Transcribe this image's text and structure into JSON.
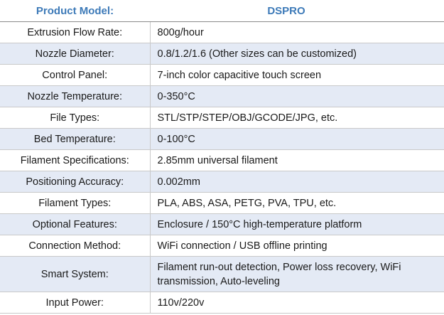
{
  "header": {
    "label": "Product Model:",
    "value": "DSPRO"
  },
  "rows": [
    {
      "label": "Extrusion Flow Rate:",
      "value": "800g/hour"
    },
    {
      "label": "Nozzle Diameter:",
      "value": "0.8/1.2/1.6 (Other sizes can be customized)"
    },
    {
      "label": "Control Panel:",
      "value": "7-inch color capacitive touch screen"
    },
    {
      "label": "Nozzle Temperature:",
      "value": "0-350°C"
    },
    {
      "label": "File Types:",
      "value": "STL/STP/STEP/OBJ/GCODE/JPG, etc."
    },
    {
      "label": "Bed Temperature:",
      "value": "0-100°C"
    },
    {
      "label": "Filament Specifications:",
      "value": "2.85mm universal filament"
    },
    {
      "label": "Positioning Accuracy:",
      "value": "0.002mm"
    },
    {
      "label": "Filament Types:",
      "value": "PLA, ABS, ASA, PETG, PVA, TPU, etc."
    },
    {
      "label": "Optional Features:",
      "value": "Enclosure / 150°C high-temperature platform"
    },
    {
      "label": "Connection Method:",
      "value": "WiFi connection / USB offline printing"
    },
    {
      "label": "Smart System:",
      "value": "Filament run-out detection, Power loss recovery, WiFi transmission, Auto-leveling"
    },
    {
      "label": "Input Power:",
      "value": "110v/220v"
    }
  ]
}
